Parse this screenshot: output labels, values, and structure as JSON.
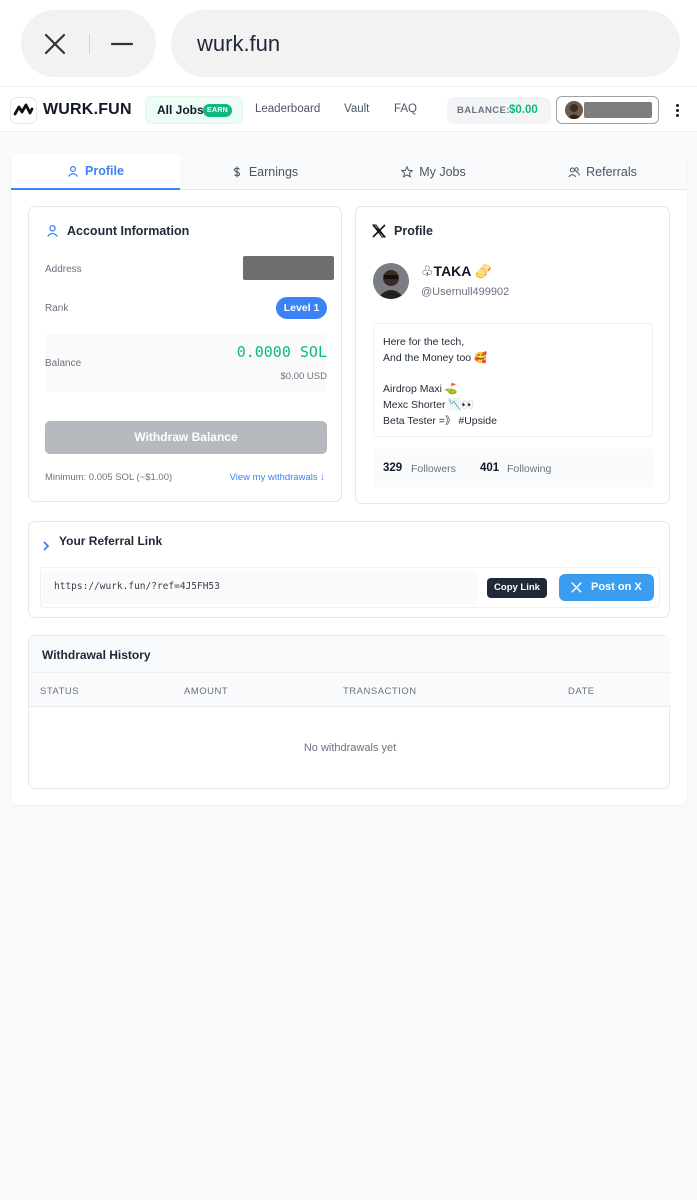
{
  "browser": {
    "url": "wurk.fun"
  },
  "nav": {
    "logo": "WURK.FUN",
    "all_jobs": "All Jobs",
    "earn_badge": "EARN",
    "leaderboard": "Leaderboard",
    "vault": "Vault",
    "faq": "FAQ",
    "balance_label": "BALANCE:",
    "balance_value": "$0.00"
  },
  "tabs": [
    {
      "label": "Profile",
      "icon": "user-icon",
      "active": true
    },
    {
      "label": "Earnings",
      "icon": "dollar-icon",
      "active": false
    },
    {
      "label": "My Jobs",
      "icon": "star-icon",
      "active": false
    },
    {
      "label": "Referrals",
      "icon": "users-icon",
      "active": false
    }
  ],
  "account": {
    "title": "Account Information",
    "address_label": "Address",
    "rank_label": "Rank",
    "rank_value": "Level 1",
    "balance_label": "Balance",
    "balance_sol": "0.0000 SOL",
    "balance_usd": "$0.00 USD",
    "withdraw_button": "Withdraw Balance",
    "minimum": "Minimum: 0.005 SOL (~$1.00)",
    "view_withdrawals": "View my withdrawals ↓"
  },
  "x_profile": {
    "title": "Profile",
    "display_name": "♧TAKA 🫔",
    "handle": "@Usernull499902",
    "bio": [
      "Here for the tech,",
      "And the Money too 🥰",
      "",
      "Airdrop Maxi ⛳",
      "Mexc Shorter 📉👀",
      "Beta Tester =》 #Upside"
    ],
    "followers_count": "329",
    "followers_label": "Followers",
    "following_count": "401",
    "following_label": "Following"
  },
  "referral": {
    "title": "Your Referral Link",
    "url": "https://wurk.fun/?ref=4J5FH53",
    "copy_button": "Copy Link",
    "post_button": "Post on X"
  },
  "withdrawals": {
    "title": "Withdrawal History",
    "columns": [
      "STATUS",
      "AMOUNT",
      "TRANSACTION",
      "DATE"
    ],
    "empty": "No withdrawals yet"
  },
  "colors": {
    "accent_blue": "#3b82f6",
    "accent_green": "#10b981"
  }
}
